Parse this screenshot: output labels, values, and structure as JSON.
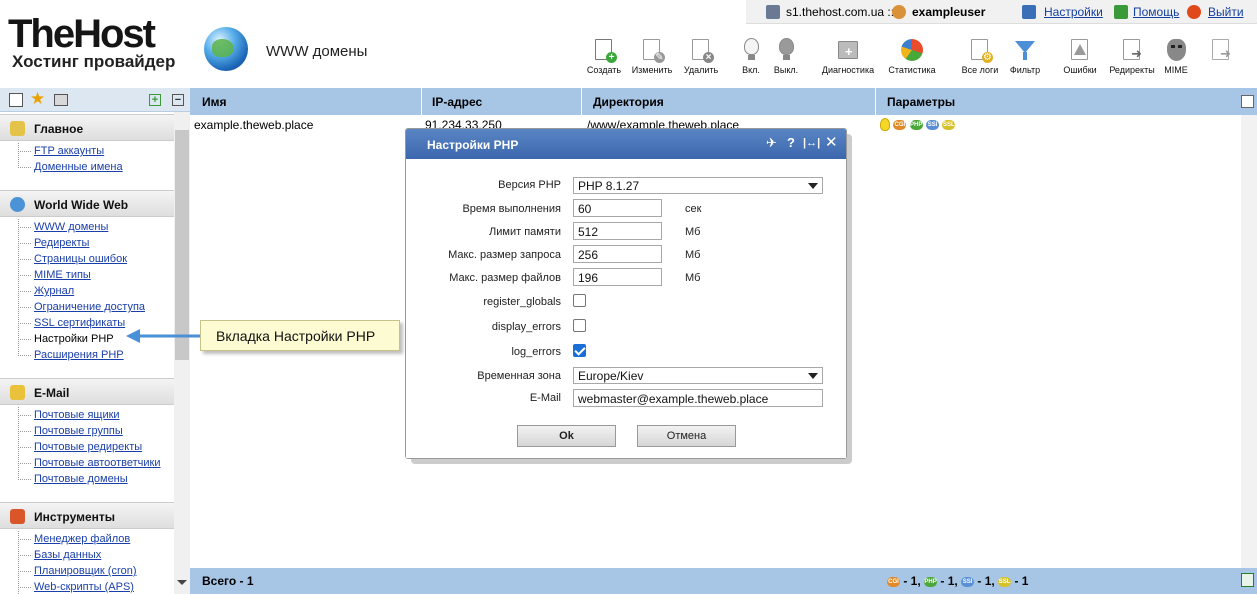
{
  "header": {
    "logo_main": "TheHost",
    "logo_sub": "Хостинг провайдер",
    "page_title": "WWW домены"
  },
  "topbar": {
    "server": "s1.thehost.com.ua ::",
    "user": "exampleuser",
    "settings": "Настройки",
    "help": "Помощь",
    "logout": "Выйти"
  },
  "toolbar": [
    {
      "label": "Создать",
      "icon": "create-icon"
    },
    {
      "label": "Изменить",
      "icon": "edit-icon"
    },
    {
      "label": "Удалить",
      "icon": "delete-icon"
    },
    {
      "label": "Вкл.",
      "icon": "enable-bulb-icon"
    },
    {
      "label": "Выкл.",
      "icon": "disable-bulb-icon"
    },
    {
      "label": "Диагностика",
      "icon": "diagnostics-icon"
    },
    {
      "label": "Статистика",
      "icon": "statistics-icon"
    },
    {
      "label": "Все логи",
      "icon": "all-logs-icon"
    },
    {
      "label": "Фильтр",
      "icon": "filter-icon"
    },
    {
      "label": "Ошибки",
      "icon": "errors-icon"
    },
    {
      "label": "Редиректы",
      "icon": "redirects-icon"
    },
    {
      "label": "MIME",
      "icon": "mime-icon"
    }
  ],
  "sidebar": {
    "sections": [
      {
        "title": "Главное",
        "items": [
          "FTP аккаунты",
          "Доменные имена"
        ]
      },
      {
        "title": "World Wide Web",
        "items": [
          "WWW домены",
          "Редиректы",
          "Страницы ошибок",
          "MIME типы",
          "Журнал",
          "Ограничение доступа",
          "SSL сертификаты",
          "Настройки PHP",
          "Расширения PHP"
        ]
      },
      {
        "title": "E-Mail",
        "items": [
          "Почтовые ящики",
          "Почтовые группы",
          "Почтовые редиректы",
          "Почтовые автоответчики",
          "Почтовые домены"
        ]
      },
      {
        "title": "Инструменты",
        "items": [
          "Менеджер файлов",
          "Базы данных",
          "Планировщик (cron)",
          "Web-скрипты (APS)"
        ]
      }
    ],
    "current_item": "Настройки PHP"
  },
  "table": {
    "headers": [
      "Имя",
      "IP-адрес",
      "Директория",
      "Параметры"
    ],
    "rows": [
      {
        "name": "example.theweb.place",
        "ip": "91.234.33.250",
        "dir": "/www/example.theweb.place"
      }
    ],
    "param_badges": [
      "CGI",
      "PHP",
      "SSI",
      "SSL"
    ],
    "footer_total": "Всего - 1",
    "footer_counts": [
      {
        "badge": "CGI",
        "text": "- 1,"
      },
      {
        "badge": "PHP",
        "text": "- 1,"
      },
      {
        "badge": "SSI",
        "text": "- 1,"
      },
      {
        "badge": "SSL",
        "text": "- 1"
      }
    ]
  },
  "callout": {
    "text": "Вкладка Настройки PHP"
  },
  "dialog": {
    "title": "Настройки PHP",
    "fields": {
      "php_version": {
        "label": "Версия PHP",
        "value": "PHP 8.1.27"
      },
      "max_execution": {
        "label": "Время выполнения",
        "value": "60",
        "unit": "сек"
      },
      "memory_limit": {
        "label": "Лимит памяти",
        "value": "512",
        "unit": "Мб"
      },
      "post_max": {
        "label": "Макс. размер запроса",
        "value": "256",
        "unit": "Мб"
      },
      "upload_max": {
        "label": "Макс. размер файлов",
        "value": "196",
        "unit": "Мб"
      },
      "register_globals": {
        "label": "register_globals",
        "checked": false
      },
      "display_errors": {
        "label": "display_errors",
        "checked": false
      },
      "log_errors": {
        "label": "log_errors",
        "checked": true
      },
      "timezone": {
        "label": "Временная зона",
        "value": "Europe/Kiev"
      },
      "email": {
        "label": "E-Mail",
        "value": "webmaster@example.theweb.place"
      }
    },
    "ok_label": "Ok",
    "cancel_label": "Отмена"
  },
  "colors": {
    "header_row": "#a7c6e6",
    "dialog_title": "#4a75b8",
    "link": "#1a3fa8",
    "checkbox_on": "#1a6fd6"
  }
}
